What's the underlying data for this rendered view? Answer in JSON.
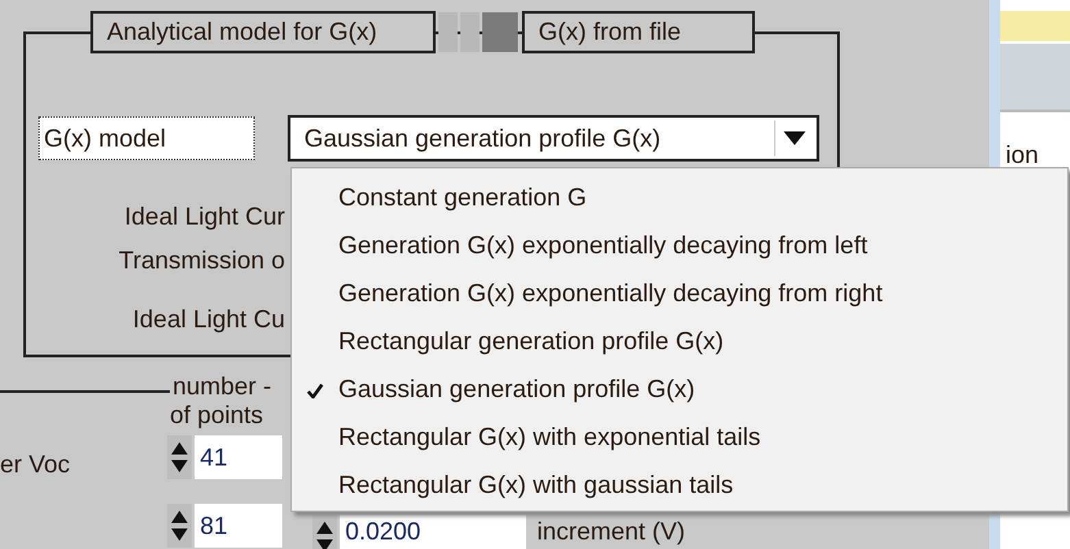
{
  "tabs": [
    {
      "label": "Analytical model for G(x)"
    },
    {
      "label": "G(x) from file"
    }
  ],
  "tab_switch": {
    "on": true
  },
  "model_label": "G(x) model",
  "model_select": {
    "value": "Gaussian generation profile G(x)",
    "expanded": true
  },
  "labels": [
    "Ideal Light Cur",
    "Transmission o",
    "Ideal Light Cu"
  ],
  "points_header": [
    "number -",
    "of points"
  ],
  "sweep_label": "er Voc",
  "spinners": [
    {
      "value": "41"
    },
    {
      "value": "81"
    }
  ],
  "increment": {
    "value": "0.0200",
    "label": "increment (V)"
  },
  "background_window": {
    "text": "ion"
  },
  "menu": [
    {
      "label": "Constant generation G",
      "selected": false
    },
    {
      "label": "Generation G(x) exponentially decaying from left",
      "selected": false
    },
    {
      "label": "Generation G(x) exponentially decaying from right",
      "selected": false
    },
    {
      "label": "Rectangular generation profile G(x)",
      "selected": false
    },
    {
      "label": "Gaussian generation profile G(x)",
      "selected": true
    },
    {
      "label": "Rectangular G(x) with exponential tails",
      "selected": false
    },
    {
      "label": "Rectangular G(x) with gaussian tails",
      "selected": false
    }
  ]
}
